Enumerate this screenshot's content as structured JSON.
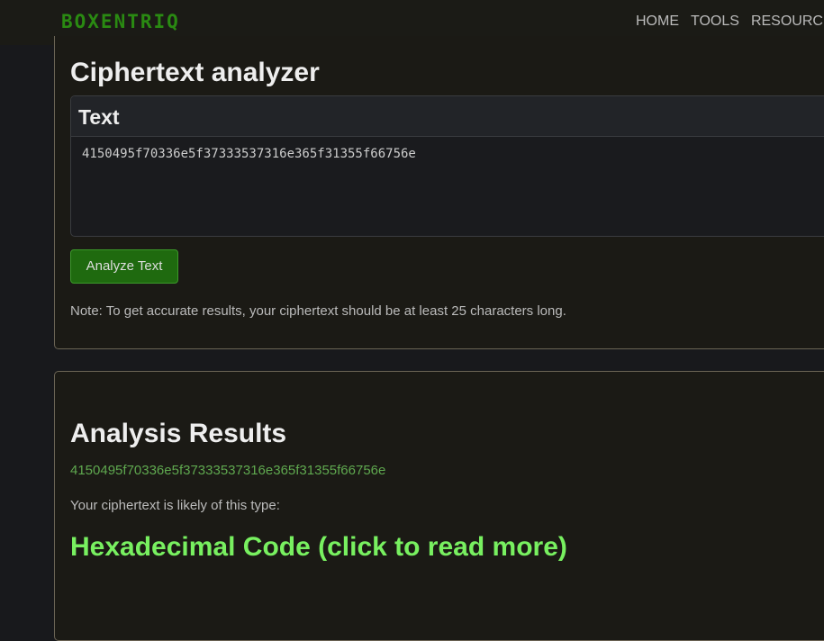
{
  "header": {
    "logo": "BOXENTRIQ",
    "nav": [
      "HOME",
      "TOOLS",
      "RESOURCES"
    ]
  },
  "analyzer": {
    "title": "Ciphertext analyzer",
    "panel_title": "Text",
    "input_value": "4150495f70336e5f37333537316e365f31355f66756e",
    "button_label": "Analyze Text",
    "note": "Note: To get accurate results, your ciphertext should be at least 25 characters long."
  },
  "results": {
    "title": "Analysis Results",
    "ciphertext": "4150495f70336e5f37333537316e365f31355f66756e",
    "likely_label": "Your ciphertext is likely of this type:",
    "type_link": "Hexadecimal Code (click to read more)"
  }
}
